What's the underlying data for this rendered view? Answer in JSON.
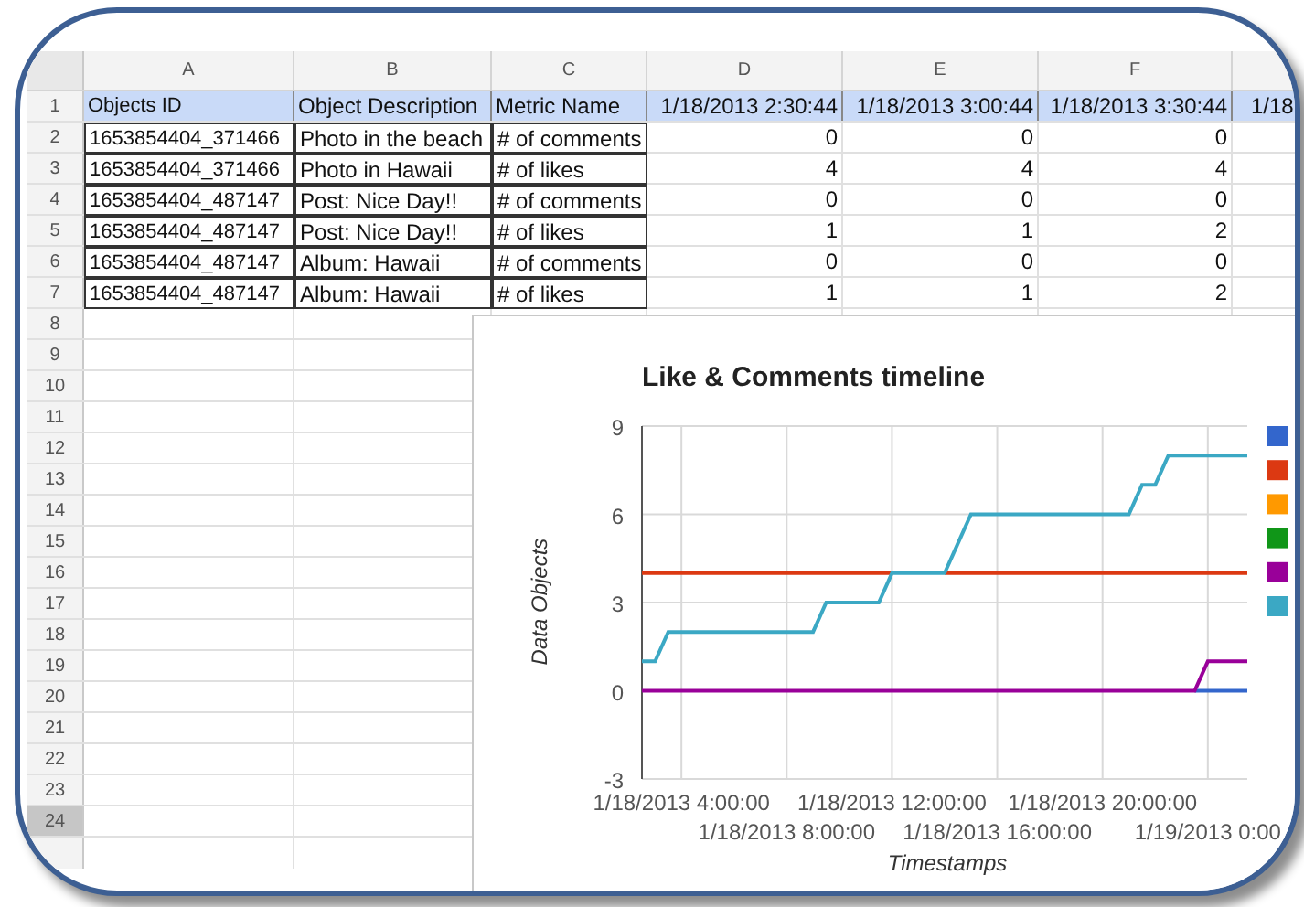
{
  "spreadsheet": {
    "column_letters": [
      "A",
      "B",
      "C",
      "D",
      "E",
      "F"
    ],
    "header_row": [
      "Objects ID",
      "Object Description",
      "Metric Name",
      "1/18/2013 2:30:44",
      "1/18/2013 3:00:44",
      "1/18/2013 3:30:44",
      "1/18"
    ],
    "rows": [
      {
        "cells": [
          "1653854404_371466",
          "Photo in the beach",
          "# of comments",
          "0",
          "0",
          "0"
        ]
      },
      {
        "cells": [
          "1653854404_371466",
          "Photo in Hawaii",
          "# of likes",
          "4",
          "4",
          "4"
        ]
      },
      {
        "cells": [
          "1653854404_487147",
          "Post: Nice Day!!",
          "# of comments",
          "0",
          "0",
          "0"
        ]
      },
      {
        "cells": [
          "1653854404_487147",
          "Post: Nice Day!!",
          "# of likes",
          "1",
          "1",
          "2"
        ]
      },
      {
        "cells": [
          "1653854404_487147",
          "Album: Hawaii",
          "# of comments",
          "0",
          "0",
          "0"
        ]
      },
      {
        "cells": [
          "1653854404_487147",
          "Album: Hawaii",
          "# of likes",
          "1",
          "1",
          "2"
        ]
      }
    ],
    "row_numbers": [
      {
        "label": "1",
        "selected": false
      },
      {
        "label": "2",
        "selected": false
      },
      {
        "label": "3",
        "selected": false
      },
      {
        "label": "4",
        "selected": false
      },
      {
        "label": "5",
        "selected": false
      },
      {
        "label": "6",
        "selected": false
      },
      {
        "label": "7",
        "selected": false
      },
      {
        "label": "8",
        "selected": false
      },
      {
        "label": "9",
        "selected": false
      },
      {
        "label": "10",
        "selected": false
      },
      {
        "label": "11",
        "selected": false
      },
      {
        "label": "12",
        "selected": false
      },
      {
        "label": "13",
        "selected": false
      },
      {
        "label": "14",
        "selected": false
      },
      {
        "label": "15",
        "selected": false
      },
      {
        "label": "16",
        "selected": false
      },
      {
        "label": "17",
        "selected": false
      },
      {
        "label": "18",
        "selected": false
      },
      {
        "label": "19",
        "selected": false
      },
      {
        "label": "20",
        "selected": false
      },
      {
        "label": "21",
        "selected": false
      },
      {
        "label": "22",
        "selected": false
      },
      {
        "label": "23",
        "selected": false
      },
      {
        "label": "24",
        "selected": true
      }
    ]
  },
  "chart": {
    "chart_data": {
      "type": "line",
      "title": "Like & Comments timeline",
      "xlabel": "Timestamps",
      "ylabel": "Data Objects",
      "categories": [
        null,
        null,
        null,
        "1/18/2013 4:00:00",
        null,
        null,
        null,
        null,
        null,
        null,
        null,
        "1/18/2013 8:00:00",
        null,
        null,
        null,
        null,
        null,
        null,
        null,
        "1/18/2013 12:00:00",
        null,
        null,
        null,
        null,
        null,
        null,
        null,
        "1/18/2013 16:00:00",
        null,
        null,
        null,
        null,
        null,
        null,
        null,
        "1/18/2013 20:00:00",
        null,
        null,
        null,
        null,
        null,
        null,
        null,
        "1/19/2013 0:00",
        null,
        null,
        null
      ],
      "series": [
        {
          "color": "#3366cc",
          "values": [
            null,
            null,
            null,
            null,
            null,
            null,
            null,
            null,
            null,
            null,
            null,
            null,
            null,
            null,
            null,
            null,
            null,
            null,
            null,
            null,
            null,
            null,
            null,
            null,
            null,
            null,
            null,
            null,
            null,
            null,
            null,
            null,
            null,
            null,
            null,
            null,
            null,
            null,
            null,
            null,
            null,
            null,
            0,
            0,
            0,
            0,
            0
          ]
        },
        {
          "color": "#dc3912",
          "values": [
            4,
            4,
            4,
            4,
            4,
            4,
            4,
            4,
            4,
            4,
            4,
            4,
            4,
            4,
            4,
            4,
            4,
            4,
            4,
            4,
            null,
            null,
            null,
            4,
            4,
            4,
            4,
            4,
            4,
            4,
            4,
            4,
            4,
            4,
            4,
            4,
            4,
            4,
            4,
            4,
            4,
            4,
            4,
            4,
            4,
            4,
            4
          ]
        },
        {
          "color": "#ff9900",
          "values": [
            null,
            null,
            null,
            null,
            null,
            null,
            null,
            null,
            null,
            null,
            null,
            null,
            null,
            null,
            null,
            null,
            null,
            null,
            null,
            null,
            null,
            null,
            null,
            null,
            null,
            null,
            null,
            null,
            null,
            null,
            null,
            null,
            null,
            null,
            null,
            null,
            null,
            null,
            null,
            null,
            null,
            null,
            null,
            null,
            null,
            null,
            null
          ]
        },
        {
          "color": "#109618",
          "values": [
            null,
            null,
            null,
            null,
            null,
            null,
            null,
            null,
            null,
            null,
            null,
            null,
            null,
            null,
            null,
            null,
            null,
            null,
            null,
            null,
            null,
            null,
            null,
            null,
            null,
            null,
            null,
            null,
            null,
            null,
            null,
            null,
            null,
            null,
            null,
            null,
            null,
            null,
            null,
            null,
            null,
            null,
            null,
            null,
            null,
            null,
            null
          ]
        },
        {
          "color": "#990099",
          "values": [
            0,
            0,
            0,
            0,
            0,
            0,
            0,
            0,
            0,
            0,
            0,
            0,
            0,
            0,
            0,
            0,
            0,
            0,
            0,
            0,
            0,
            0,
            0,
            0,
            0,
            0,
            0,
            0,
            0,
            0,
            0,
            0,
            0,
            0,
            0,
            0,
            0,
            0,
            0,
            0,
            0,
            0,
            0,
            1,
            1,
            1,
            1
          ]
        },
        {
          "color": "#3ba8c4",
          "values": [
            1,
            1,
            2,
            2,
            2,
            2,
            2,
            2,
            2,
            2,
            2,
            2,
            2,
            2,
            3,
            3,
            3,
            3,
            3,
            4,
            4,
            4,
            4,
            4,
            5,
            6,
            6,
            6,
            6,
            6,
            6,
            6,
            6,
            6,
            6,
            6,
            6,
            6,
            7,
            7,
            8,
            8,
            8,
            8,
            8,
            8,
            8
          ]
        }
      ],
      "grid": true,
      "ylim": [
        -3,
        9
      ],
      "yticks": [
        -3,
        0,
        3,
        6,
        9
      ]
    }
  }
}
